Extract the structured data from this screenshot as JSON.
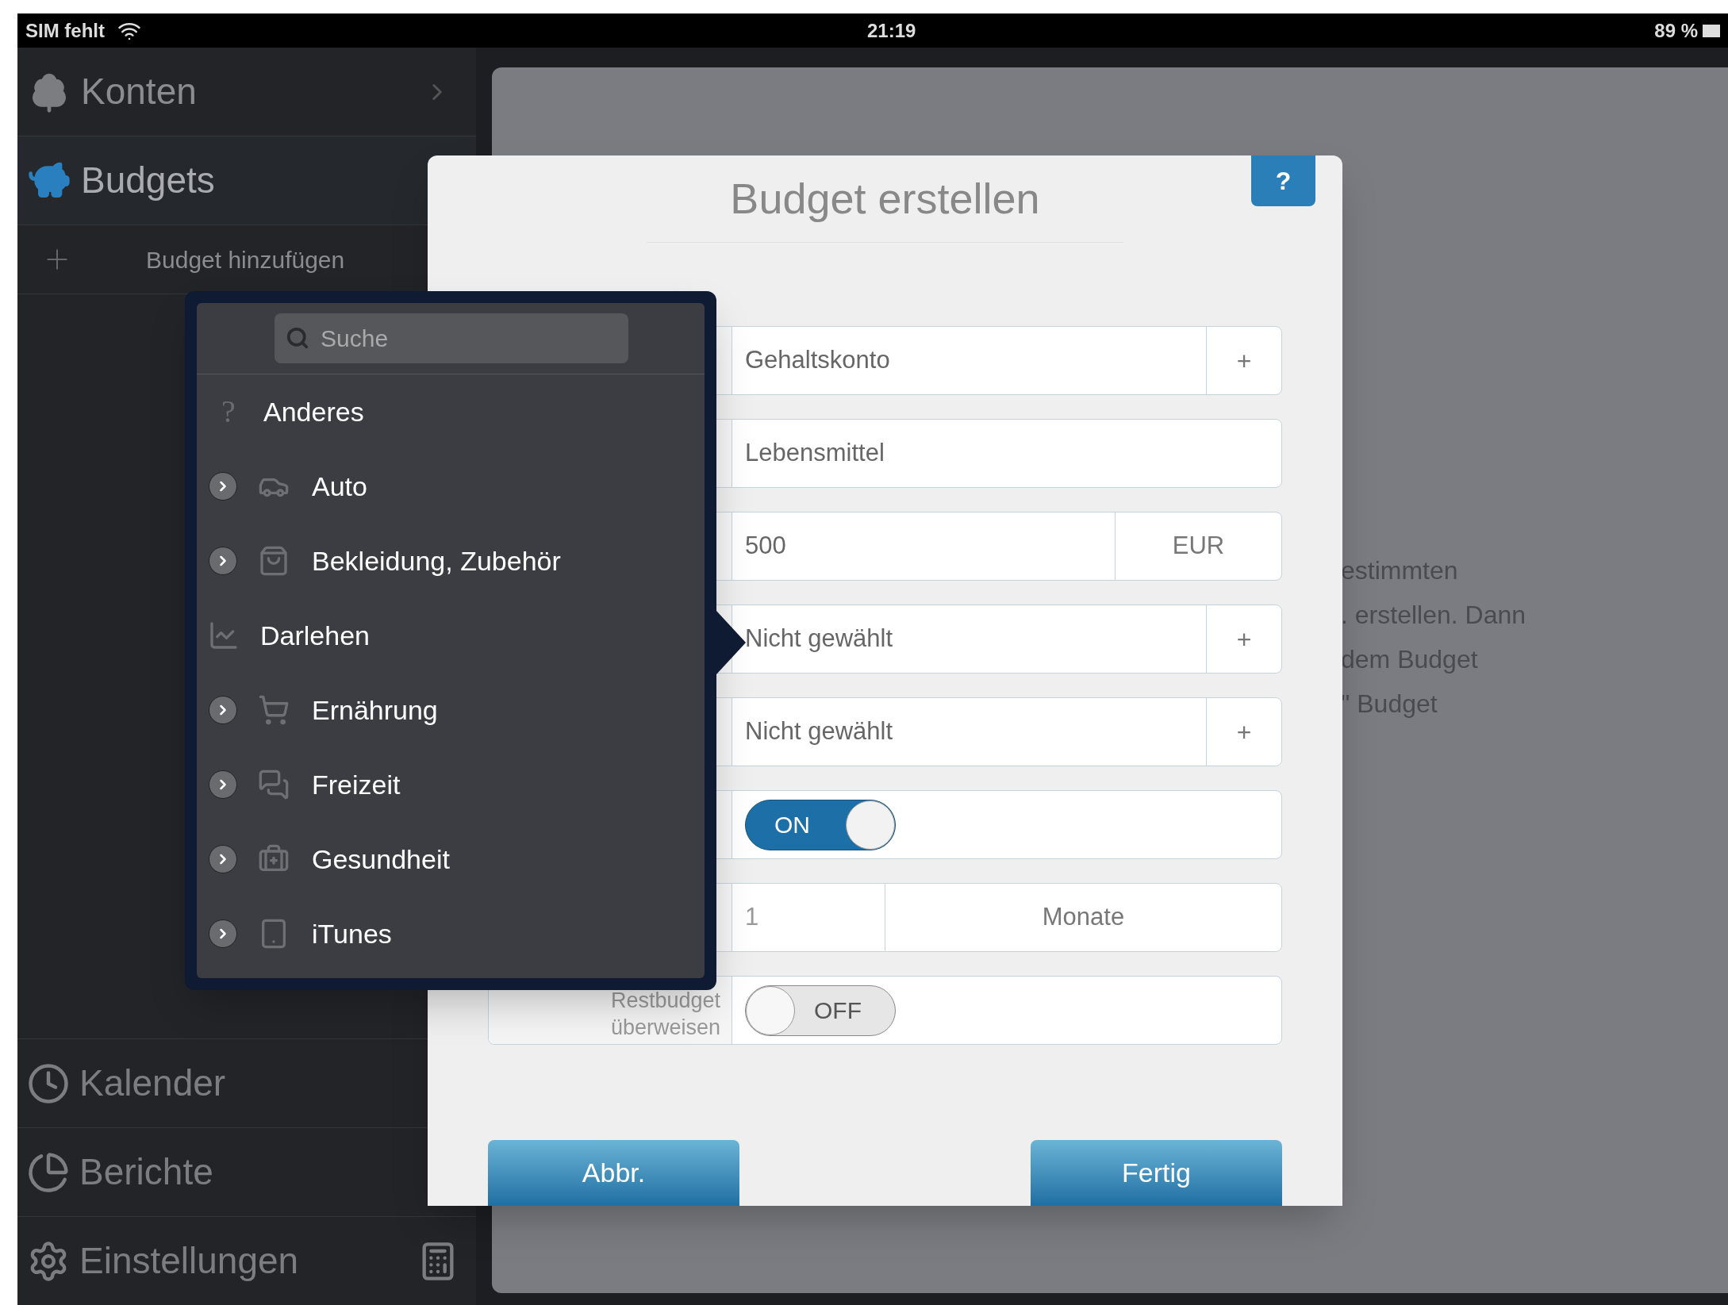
{
  "status_bar": {
    "carrier": "SIM fehlt",
    "time": "21:19",
    "battery": "89 %"
  },
  "sidebar": {
    "items": [
      {
        "label": "Konten",
        "selected": false
      },
      {
        "label": "Budgets",
        "selected": true
      }
    ],
    "add_item": {
      "label": "Budget hinzufügen"
    },
    "bottom_items": [
      {
        "label": "Kalender"
      },
      {
        "label": "Berichte"
      },
      {
        "label": "Einstellungen"
      }
    ]
  },
  "background_text": [
    "estimmten",
    ". erstellen. Dann",
    "dem Budget",
    "\" Budget"
  ],
  "dialog": {
    "title": "Budget erstellen",
    "help": "?",
    "rows": [
      {
        "kind": "select",
        "value": "Gehaltskonto",
        "action": "+"
      },
      {
        "kind": "text",
        "value": "Lebensmittel"
      },
      {
        "kind": "amount",
        "value": "500",
        "unit": "EUR"
      },
      {
        "kind": "select",
        "value": "Nicht gewählt",
        "action": "+"
      },
      {
        "kind": "select",
        "value": "Nicht gewählt",
        "action": "+"
      },
      {
        "kind": "toggle",
        "on": true,
        "text": "ON"
      },
      {
        "kind": "period",
        "value": "1",
        "unit": "Monate"
      },
      {
        "kind": "toggle",
        "label": "Restbudget überweisen",
        "on": false,
        "text": "OFF"
      }
    ],
    "buttons": [
      "Abbr.",
      "Fertig"
    ]
  },
  "popover": {
    "search": {
      "placeholder": "Suche"
    },
    "items": [
      {
        "label": "Anderes",
        "glyph": "?",
        "expandable": false
      },
      {
        "label": "Auto",
        "expandable": true
      },
      {
        "label": "Bekleidung, Zubehör",
        "expandable": true
      },
      {
        "label": "Darlehen",
        "expandable": false
      },
      {
        "label": "Ernährung",
        "expandable": true
      },
      {
        "label": "Freizeit",
        "expandable": true
      },
      {
        "label": "Gesundheit",
        "expandable": true
      },
      {
        "label": "iTunes",
        "expandable": true
      }
    ]
  }
}
